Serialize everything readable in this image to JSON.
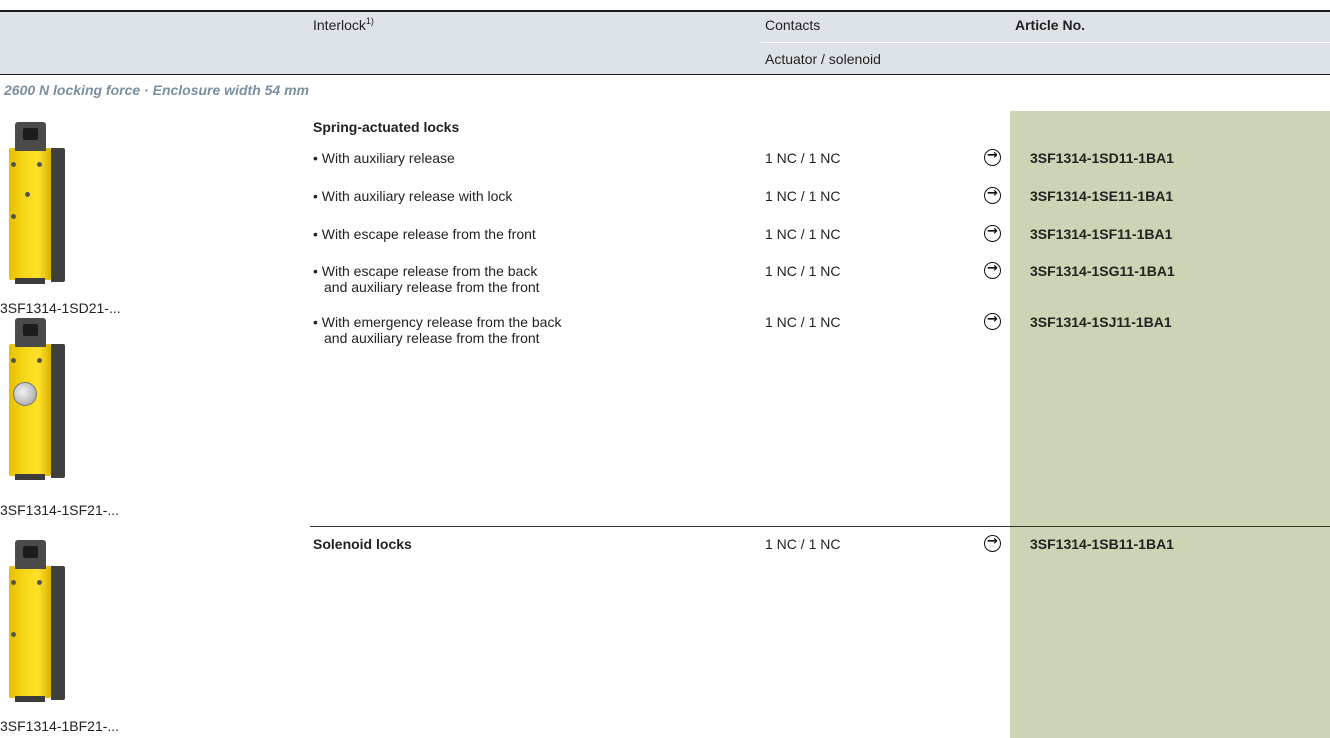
{
  "header": {
    "interlock_label": "Interlock",
    "interlock_footnote": "1)",
    "contacts_label": "Contacts",
    "actuator_label": "Actuator / solenoid",
    "article_label": "Article No."
  },
  "section_title": "2600 N locking force · Enclosure width 54 mm",
  "groups": [
    {
      "title": "Spring-actuated locks",
      "rows": [
        {
          "desc": "• With auxiliary release",
          "desc2": "",
          "contacts": "1 NC / 1 NC",
          "article": "3SF1314-1SD11-1BA1"
        },
        {
          "desc": "• With auxiliary release with lock",
          "desc2": "",
          "contacts": "1 NC / 1 NC",
          "article": "3SF1314-1SE11-1BA1"
        },
        {
          "desc": "• With escape release from the front",
          "desc2": "",
          "contacts": "1 NC / 1 NC",
          "article": "3SF1314-1SF11-1BA1"
        },
        {
          "desc": "• With escape release from the back",
          "desc2": "and auxiliary release from the front",
          "contacts": "1 NC / 1 NC",
          "article": "3SF1314-1SG11-1BA1"
        },
        {
          "desc": "• With emergency release from the back",
          "desc2": "and auxiliary release from the front",
          "contacts": "1 NC / 1 NC",
          "article": "3SF1314-1SJ11-1BA1"
        }
      ]
    },
    {
      "title": "Solenoid locks",
      "contacts": "1 NC / 1 NC",
      "article": "3SF1314-1SB11-1BA1"
    }
  ],
  "product_images": [
    {
      "caption": "3SF1314-1SD21-...",
      "variant": "standard"
    },
    {
      "caption": "3SF1314-1SF21-...",
      "variant": "escape-knob"
    },
    {
      "caption": "3SF1314-1BF21-...",
      "variant": "standard"
    }
  ],
  "colors": {
    "header_band": "#dde3e9",
    "article_column": "#cbd5b5",
    "section_title": "#7b8fa3",
    "device_yellow": "#f7da1a"
  },
  "icons": {
    "order_arrow": "circled-arrow-right-icon"
  }
}
